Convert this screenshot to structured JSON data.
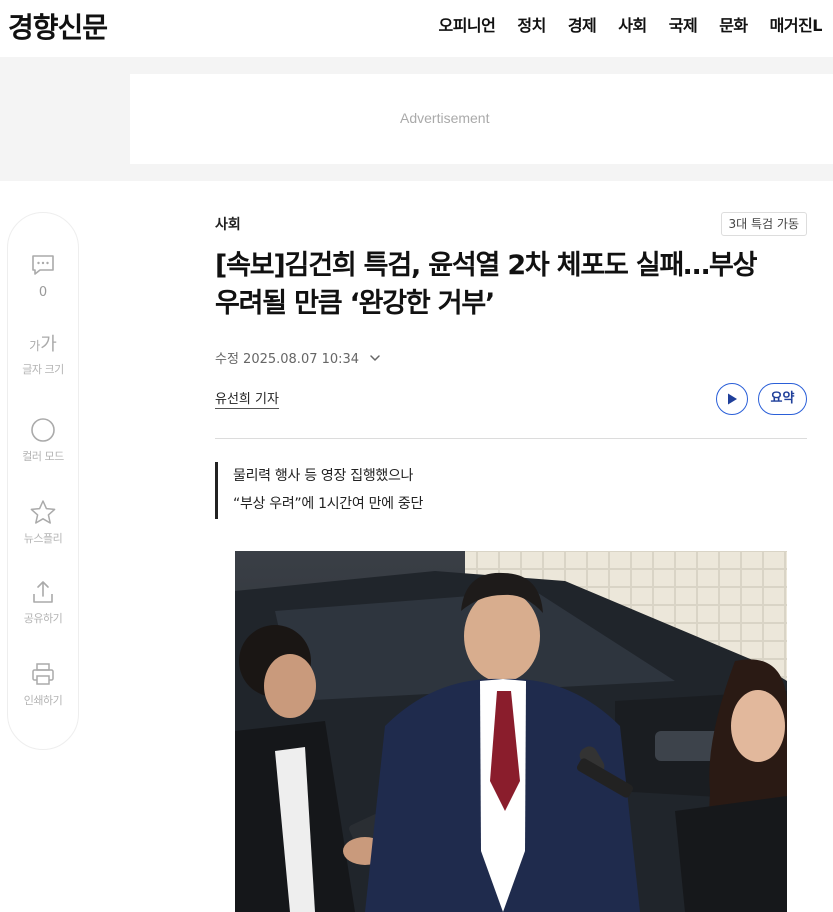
{
  "header": {
    "logo": "경향신문",
    "nav": [
      "오피니언",
      "정치",
      "경제",
      "사회",
      "국제",
      "문화",
      "매거진L"
    ]
  },
  "ad": {
    "label": "Advertisement"
  },
  "sidebar": {
    "comments_count": "0",
    "font_icon_small": "가",
    "font_icon_large": "가",
    "font_size_label": "글자 크기",
    "color_mode_label": "컬러 모드",
    "newsfully_label": "뉴스플리",
    "share_label": "공유하기",
    "print_label": "인쇄하기"
  },
  "article": {
    "section": "사회",
    "badge": "3대 특검 가동",
    "headline": "[속보]김건희 특검, 윤석열 2차 체포도 실패…부상 우려될 만큼 ‘완강한 거부’",
    "dateline": "수정 2025.08.07 10:34",
    "reporter": "유선희 기자",
    "summary_button": "요약",
    "subheads": [
      "물리력 행사 등 영장 집행했으나",
      "“부상 우려”에 1시간여 만에 중단"
    ]
  },
  "colors": {
    "accent": "#2a5fd8",
    "ad_background": "#f4f4f4"
  }
}
